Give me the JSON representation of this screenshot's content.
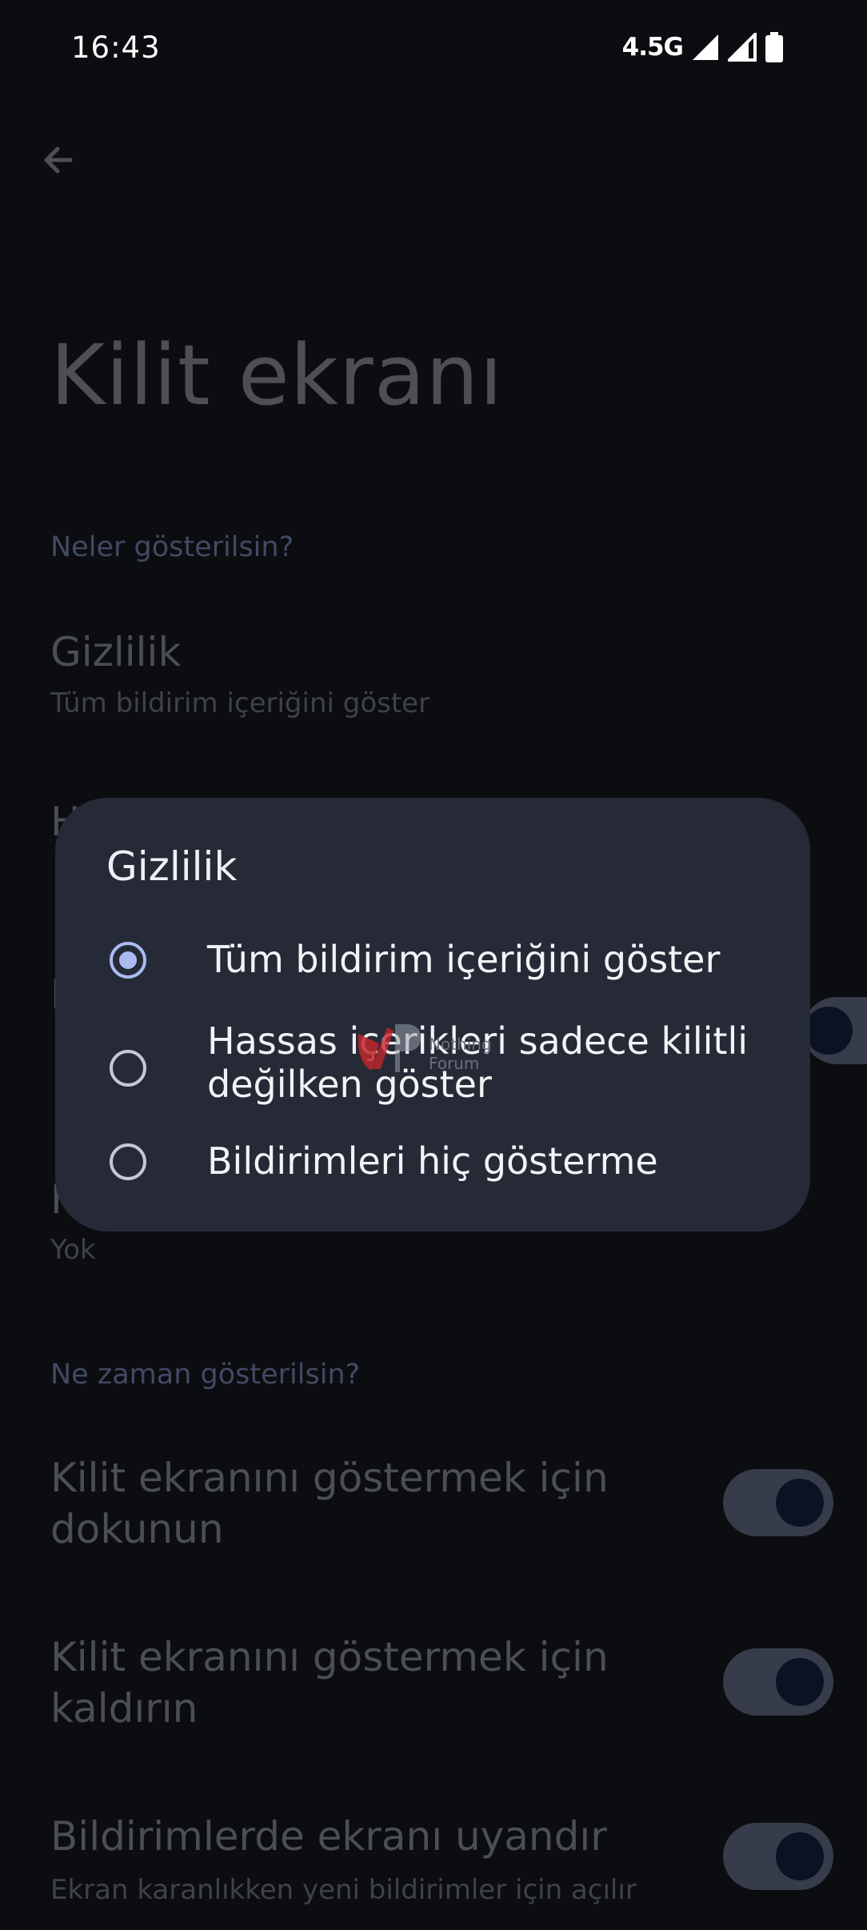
{
  "status_bar": {
    "time": "16:43",
    "network": "4.5G",
    "icons": [
      "signal-icon",
      "signal-icon",
      "battery-icon"
    ]
  },
  "header": {
    "back_icon": "back-arrow-icon",
    "title": "Kilit ekranı"
  },
  "sections": {
    "what_to_show": "Neler gösterilsin?",
    "when_to_show": "Ne zaman gösterilsin?"
  },
  "privacy_pref": {
    "title": "Gizlilik",
    "summary": "Tüm bildirim içeriğini göster"
  },
  "hidden_pref": {
    "summary": "Yok"
  },
  "toggles": [
    {
      "title_line1": "Kilit ekranını göstermek için",
      "title_line2": "dokunun",
      "on": true
    },
    {
      "title_line1": "Kilit ekranını göstermek için",
      "title_line2": "kaldırın",
      "on": true
    },
    {
      "title": "Bildirimlerde ekranı uyandır",
      "summary": "Ekran karanlıkken yeni bildirimler için açılır",
      "on": true
    }
  ],
  "dialog": {
    "title": "Gizlilik",
    "options": [
      {
        "label": "Tüm bildirim içeriğini göster",
        "selected": true
      },
      {
        "label_line1": "Hassas içerikleri sadece kilitli",
        "label_line2": "değilken göster",
        "selected": false
      },
      {
        "label": "Bildirimleri hiç gösterme",
        "selected": false
      }
    ]
  },
  "watermark": {
    "line1": "Nothing",
    "line2": "Forum"
  },
  "colors": {
    "background": "#0c0d10",
    "dialog": "#252a36",
    "accent": "#aabbf0",
    "section_header": "#404a63"
  }
}
